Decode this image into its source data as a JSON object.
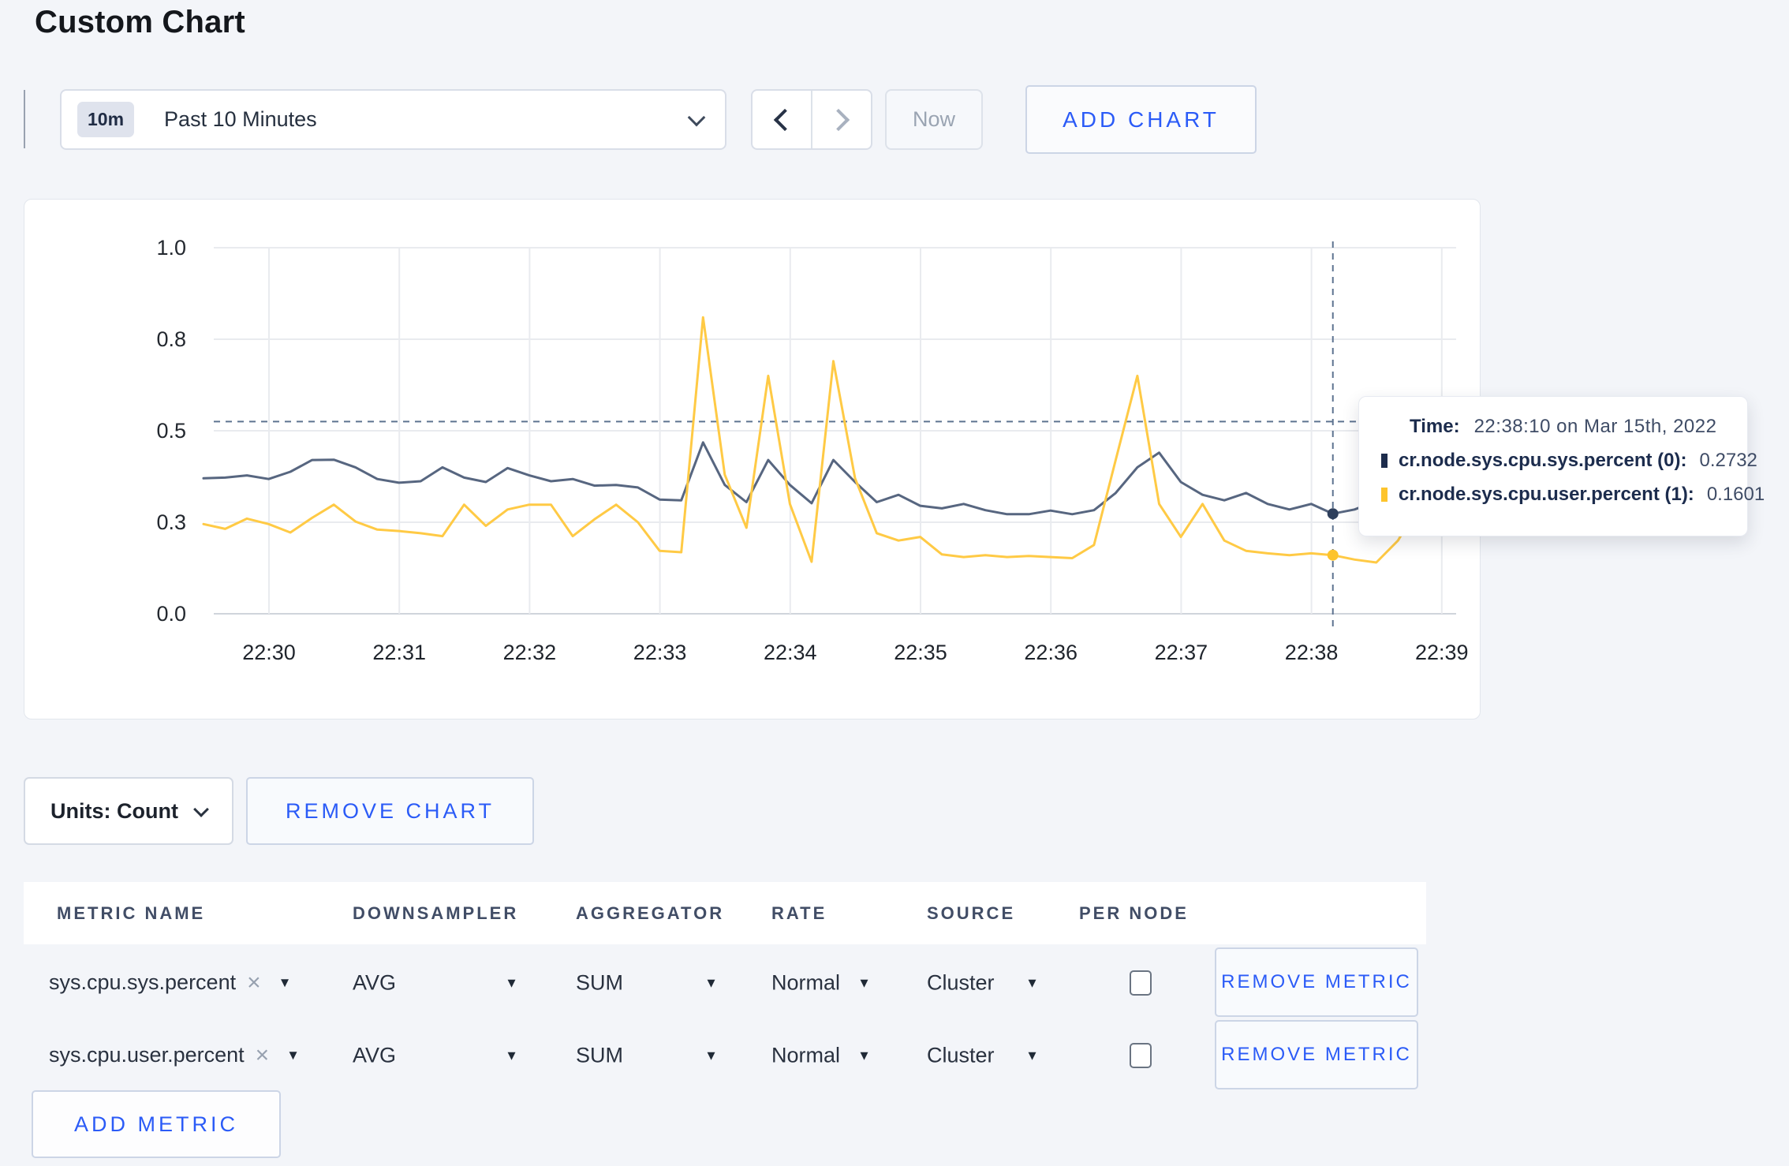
{
  "page": {
    "title": "Custom Chart",
    "background": "#f3f5f9"
  },
  "toolbar": {
    "time_badge": "10m",
    "time_label": "Past 10 Minutes",
    "now_label": "Now",
    "add_chart_label": "ADD CHART",
    "icons": {
      "time_dropdown": "chevron-down",
      "prev": "chevron-left",
      "next": "chevron-right"
    }
  },
  "chart_data": {
    "type": "line",
    "title": "",
    "xlabel": "",
    "ylabel": "",
    "x_ticks": [
      "22:30",
      "22:31",
      "22:32",
      "22:33",
      "22:34",
      "22:35",
      "22:36",
      "22:37",
      "22:38",
      "22:39"
    ],
    "y_ticks": [
      {
        "label": "1.0",
        "v": 1.0
      },
      {
        "label": "0.8",
        "v": 0.75
      },
      {
        "label": "0.5",
        "v": 0.5
      },
      {
        "label": "0.3",
        "v": 0.25
      },
      {
        "label": "0.0",
        "v": 0.0
      }
    ],
    "ylim": [
      0,
      1.0
    ],
    "grid": true,
    "x_start": "22:29:30",
    "x_interval_seconds": 10,
    "series": [
      {
        "name": "cr.node.sys.cpu.sys.percent (0)",
        "color": "#576680",
        "values": [
          0.37,
          0.372,
          0.378,
          0.368,
          0.388,
          0.42,
          0.421,
          0.4,
          0.368,
          0.358,
          0.362,
          0.4,
          0.372,
          0.36,
          0.398,
          0.378,
          0.362,
          0.368,
          0.35,
          0.352,
          0.345,
          0.312,
          0.31,
          0.468,
          0.352,
          0.305,
          0.42,
          0.352,
          0.302,
          0.42,
          0.36,
          0.305,
          0.325,
          0.295,
          0.288,
          0.3,
          0.283,
          0.272,
          0.272,
          0.282,
          0.272,
          0.283,
          0.33,
          0.4,
          0.44,
          0.36,
          0.325,
          0.31,
          0.33,
          0.3,
          0.285,
          0.3,
          0.2732,
          0.285,
          0.308,
          0.298,
          0.3,
          0.308
        ]
      },
      {
        "name": "cr.node.sys.cpu.user.percent (1)",
        "color": "#ffca45",
        "values": [
          0.245,
          0.232,
          0.26,
          0.245,
          0.222,
          0.262,
          0.298,
          0.252,
          0.23,
          0.226,
          0.22,
          0.212,
          0.298,
          0.24,
          0.285,
          0.298,
          0.298,
          0.212,
          0.258,
          0.298,
          0.25,
          0.172,
          0.168,
          0.81,
          0.38,
          0.235,
          0.65,
          0.3,
          0.142,
          0.69,
          0.37,
          0.22,
          0.2,
          0.21,
          0.162,
          0.155,
          0.16,
          0.155,
          0.158,
          0.155,
          0.152,
          0.188,
          0.42,
          0.65,
          0.3,
          0.21,
          0.3,
          0.2,
          0.172,
          0.165,
          0.16,
          0.165,
          0.1601,
          0.148,
          0.14,
          0.2,
          0.3,
          0.24
        ]
      }
    ],
    "crosshair": {
      "index": 52,
      "hline_value": 0.525,
      "time_label": "Time:",
      "time_value": "22:38:10 on Mar 15th, 2022",
      "entries": [
        {
          "label": "cr.node.sys.cpu.sys.percent (0):",
          "value": "0.2732",
          "color": "#1d2c4c"
        },
        {
          "label": "cr.node.sys.cpu.user.percent (1):",
          "value": "0.1601",
          "color": "#fdc42c"
        }
      ]
    }
  },
  "units_bar": {
    "units_label": "Units: Count",
    "remove_chart_label": "REMOVE CHART"
  },
  "metrics_table": {
    "headers": [
      "METRIC NAME",
      "DOWNSAMPLER",
      "AGGREGATOR",
      "RATE",
      "SOURCE",
      "PER NODE"
    ],
    "icons": {
      "clear": "×",
      "caret": "▼"
    },
    "rows": [
      {
        "metric": "sys.cpu.sys.percent",
        "downsampler": "AVG",
        "aggregator": "SUM",
        "rate": "Normal",
        "source": "Cluster",
        "per_node_checked": false,
        "remove_label": "REMOVE METRIC"
      },
      {
        "metric": "sys.cpu.user.percent",
        "downsampler": "AVG",
        "aggregator": "SUM",
        "rate": "Normal",
        "source": "Cluster",
        "per_node_checked": false,
        "remove_label": "REMOVE METRIC"
      }
    ],
    "add_metric_label": "ADD METRIC"
  }
}
